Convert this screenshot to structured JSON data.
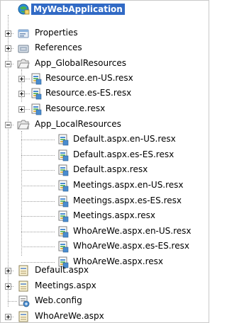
{
  "solution_explorer": {
    "project": "MyWebApplication",
    "nodes": {
      "properties": "Properties",
      "references": "References",
      "app_global": "App_GlobalResources",
      "global_items": [
        "Resource.en-US.resx",
        "Resource.es-ES.resx",
        "Resource.resx"
      ],
      "app_local": "App_LocalResources",
      "local_items": [
        "Default.aspx.en-US.resx",
        "Default.aspx.es-ES.resx",
        "Default.aspx.resx",
        "Meetings.aspx.en-US.resx",
        "Meetings.aspx.es-ES.resx",
        "Meetings.aspx.resx",
        "WhoAreWe.aspx.en-US.resx",
        "WhoAreWe.aspx.es-ES.resx",
        "WhoAreWe.aspx.resx"
      ],
      "default_aspx": "Default.aspx",
      "meetings_aspx": "Meetings.aspx",
      "web_config": "Web.config",
      "whoarewe_aspx": "WhoAreWe.aspx"
    },
    "icons": {
      "project": "web-project-icon",
      "properties": "properties-icon",
      "references": "references-icon",
      "folder_open": "open-folder-icon",
      "resource_file": "resx-file-icon",
      "aspx_file": "aspx-page-icon",
      "config_file": "web-config-icon"
    },
    "colors": {
      "selection": "#316ac5",
      "selection_text": "#ffffff",
      "tree_lines": "#a0a0a0",
      "toggle_border": "#949494"
    }
  }
}
